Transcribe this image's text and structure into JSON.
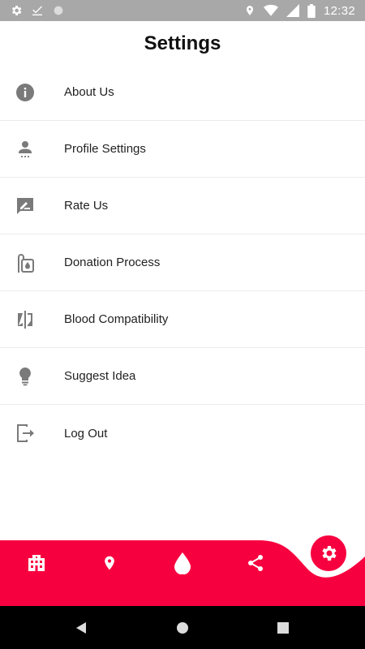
{
  "status_bar": {
    "time": "12:32",
    "left_icons": [
      "gear-icon",
      "checkmark-icon",
      "circle-icon"
    ],
    "right_icons": [
      "location-icon",
      "wifi-icon",
      "signal-icon",
      "battery-icon"
    ]
  },
  "header": {
    "title": "Settings"
  },
  "settings": {
    "items": [
      {
        "label": "About Us",
        "icon": "info-icon"
      },
      {
        "label": "Profile Settings",
        "icon": "person-icon"
      },
      {
        "label": "Rate Us",
        "icon": "rate-review-icon"
      },
      {
        "label": "Donation Process",
        "icon": "blood-bag-icon"
      },
      {
        "label": "Blood Compatibility",
        "icon": "compare-icon"
      },
      {
        "label": "Suggest Idea",
        "icon": "lightbulb-icon"
      },
      {
        "label": "Log Out",
        "icon": "logout-icon"
      }
    ]
  },
  "bottom_nav": {
    "items": [
      "hospital-icon",
      "location-pin-icon",
      "blood-drop-icon",
      "share-icon",
      "settings-gear-icon"
    ],
    "active": "settings-gear-icon",
    "accent_color": "#f7003f"
  },
  "system_nav": {
    "items": [
      "back-icon",
      "home-icon",
      "recents-icon"
    ]
  }
}
